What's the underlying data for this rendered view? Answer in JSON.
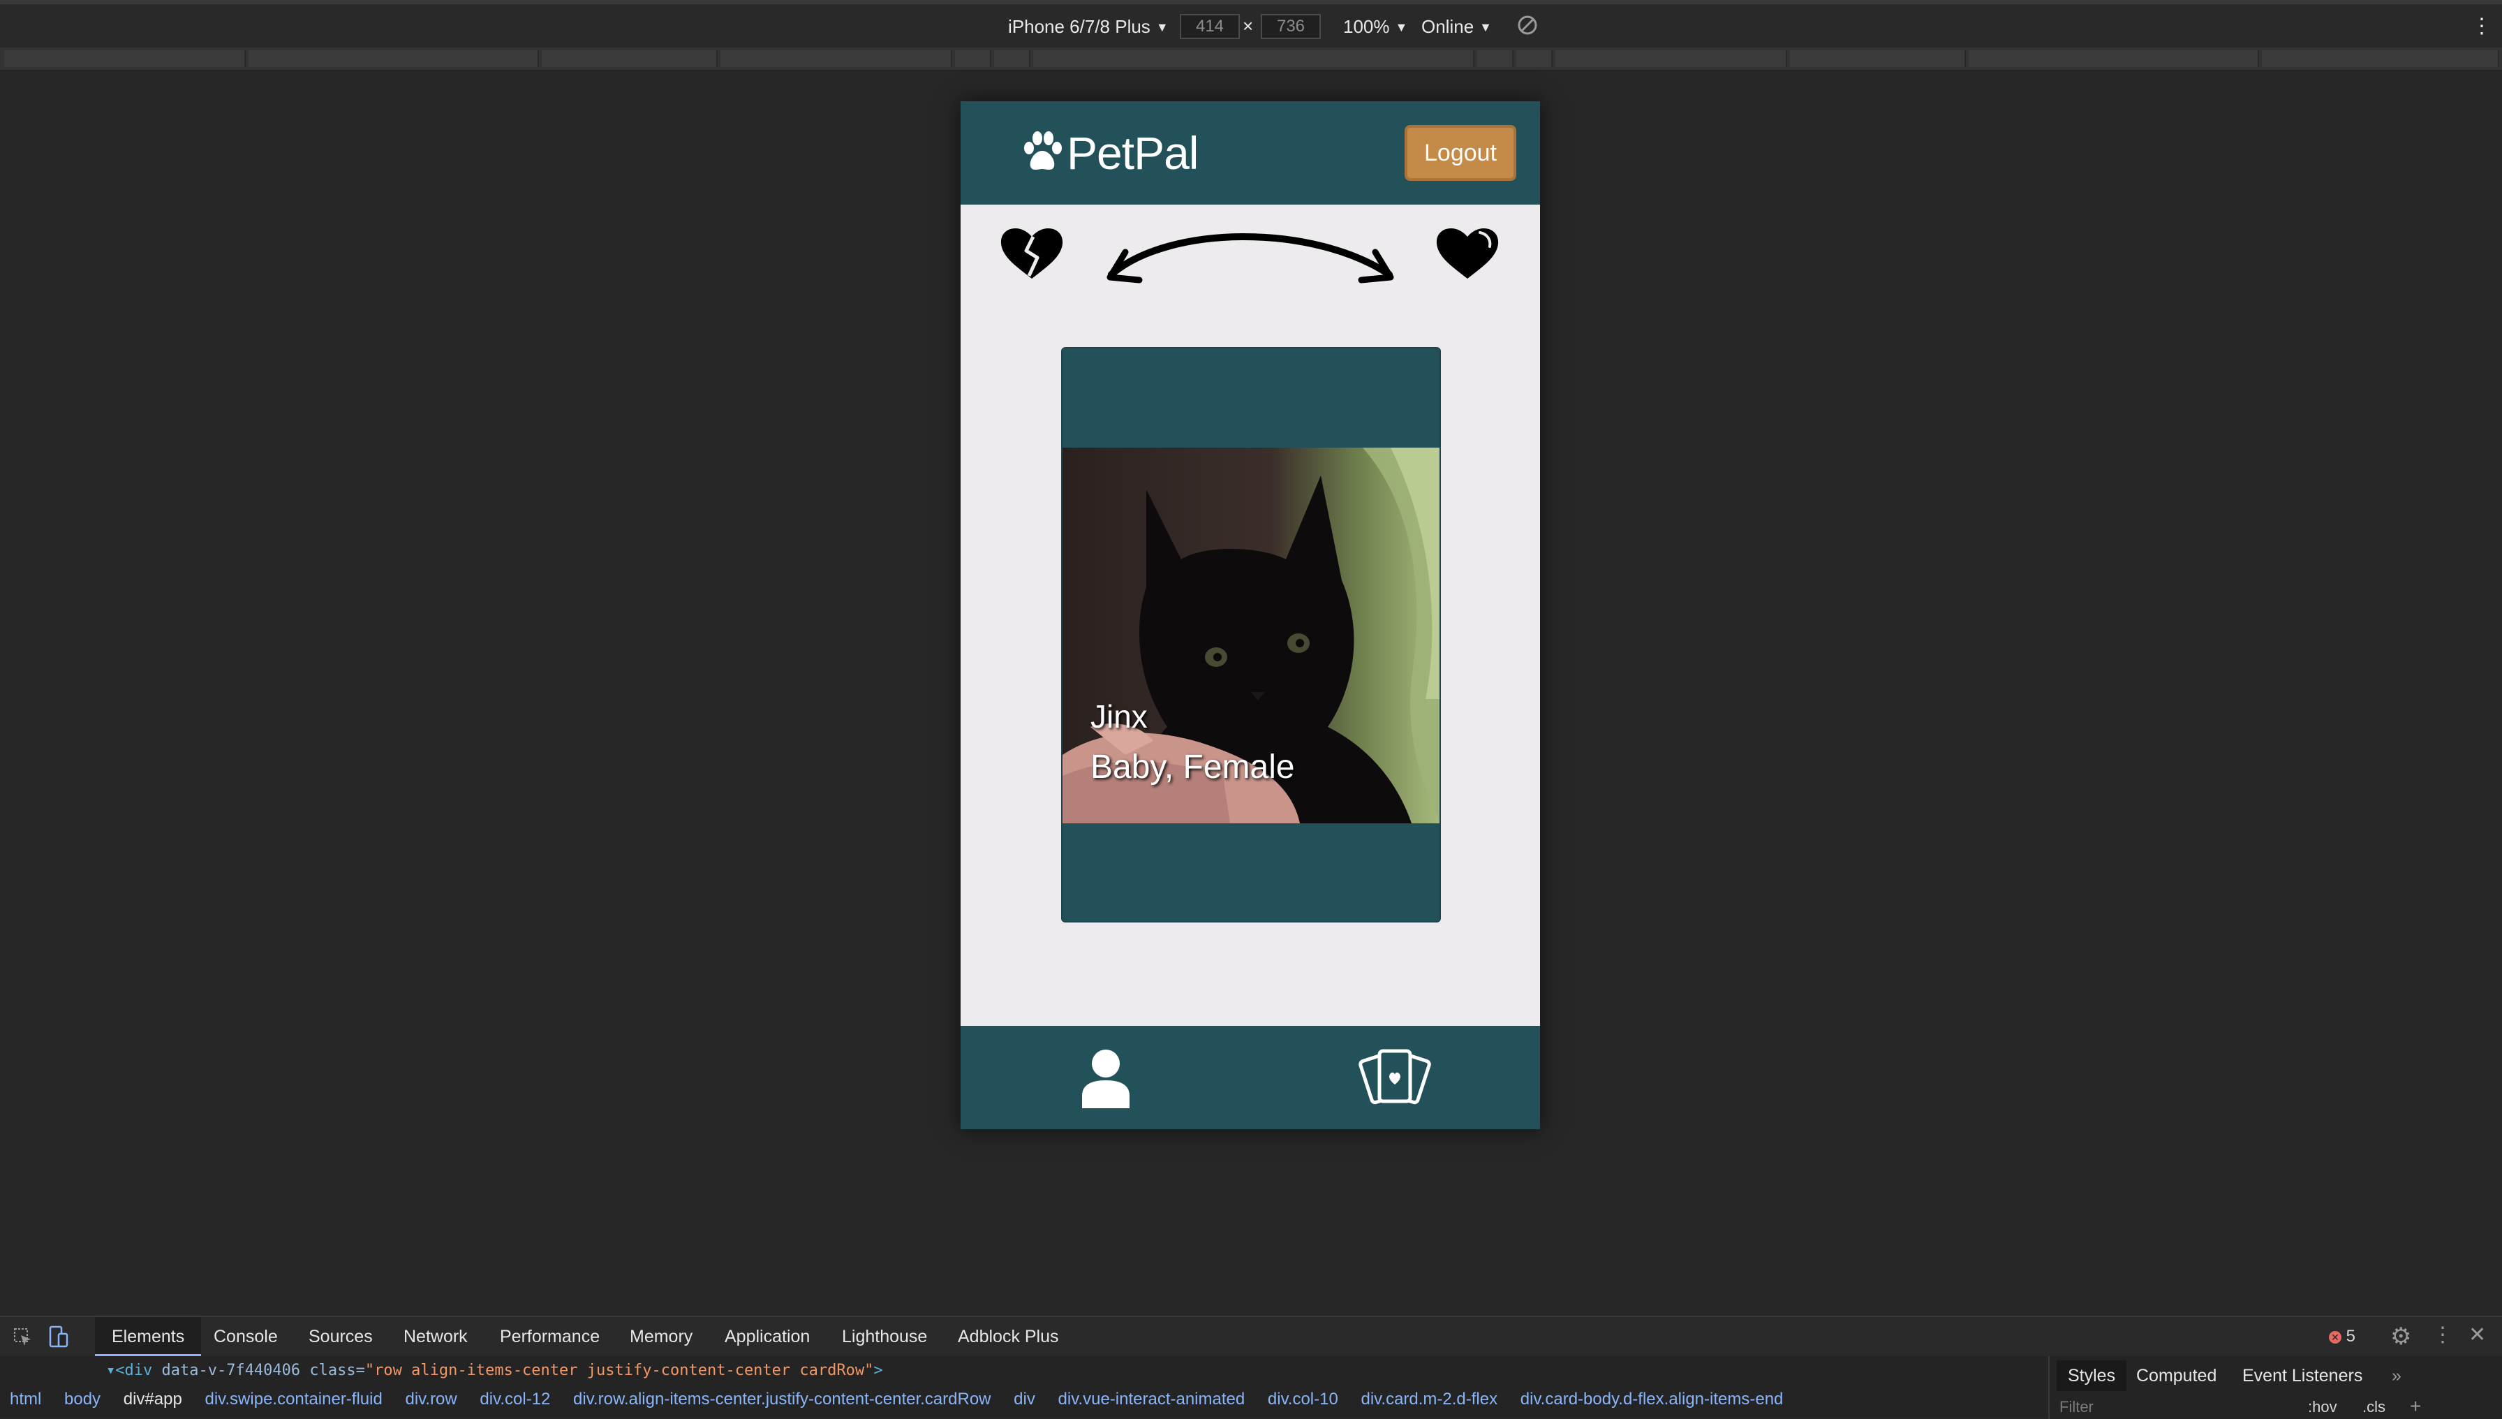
{
  "device_toolbar": {
    "device": "iPhone 6/7/8 Plus",
    "width": "414",
    "height": "736",
    "times": "×",
    "zoom": "100%",
    "network": "Online"
  },
  "app": {
    "brand": "PetPal",
    "logout_label": "Logout",
    "pet": {
      "name": "Jinx",
      "details": "Baby, Female"
    },
    "colors": {
      "header": "#23515a",
      "logout": "#c38a48",
      "background": "#eeebee"
    }
  },
  "devtools": {
    "tabs": [
      "Elements",
      "Console",
      "Sources",
      "Network",
      "Performance",
      "Memory",
      "Application",
      "Lighthouse",
      "Adblock Plus"
    ],
    "error_count": "5",
    "code_line": {
      "open": "▾<div ",
      "attr1": "data-v-7f440406",
      "attr2": " class=",
      "value": "\"row align-items-center justify-content-center cardRow\"",
      "close": ">"
    },
    "breadcrumb": [
      "html",
      "body",
      "div#app",
      "div.swipe.container-fluid",
      "div.row",
      "div.col-12",
      "div.row.align-items-center.justify-content-center.cardRow",
      "div",
      "div.vue-interact-animated",
      "div.col-10",
      "div.card.m-2.d-flex",
      "div.card-body.d-flex.align-items-end"
    ],
    "styles_tabs": [
      "Styles",
      "Computed",
      "Event Listeners"
    ],
    "filter_placeholder": "Filter",
    "hov_label": ":hov",
    "cls_label": ".cls"
  }
}
